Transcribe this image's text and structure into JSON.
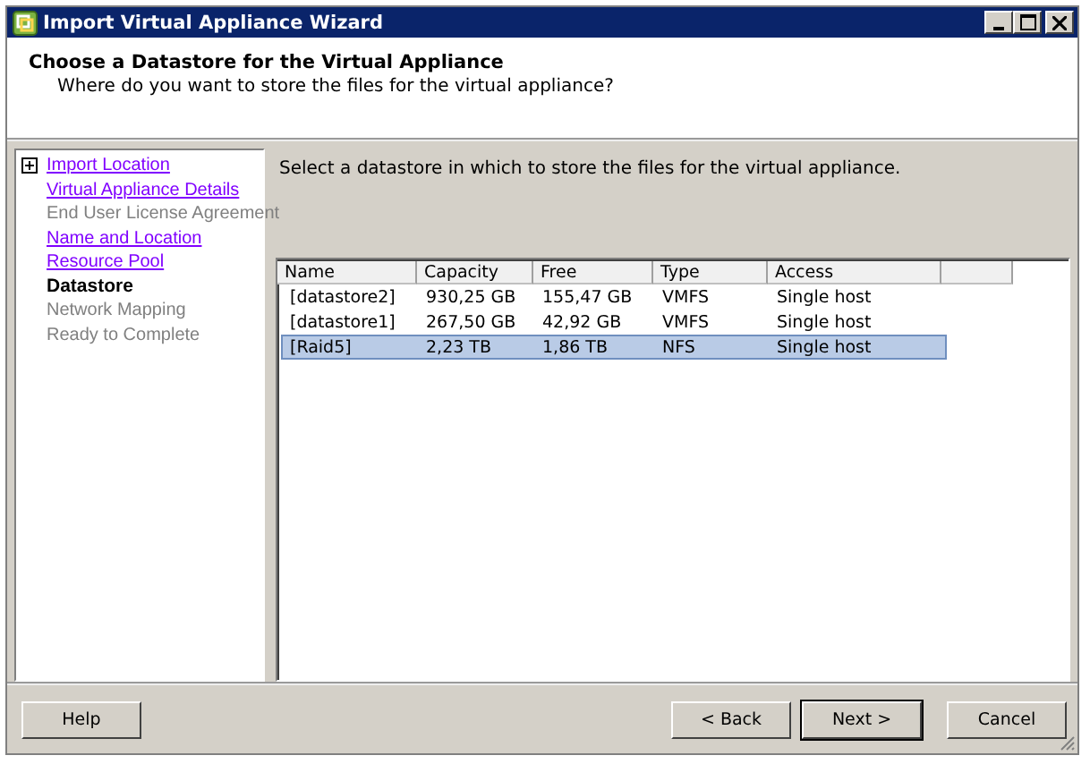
{
  "window": {
    "title": "Import Virtual Appliance Wizard"
  },
  "header": {
    "title": "Choose a Datastore for the Virtual Appliance",
    "subtitle": "Where do you want to store the files for the virtual appliance?"
  },
  "steps": [
    {
      "label": "Import Location",
      "kind": "link",
      "expandable": true
    },
    {
      "label": "Virtual Appliance Details",
      "kind": "link",
      "expandable": false
    },
    {
      "label": "End User License Agreement",
      "kind": "disabled",
      "expandable": false
    },
    {
      "label": "Name and Location",
      "kind": "link",
      "expandable": false
    },
    {
      "label": "Resource Pool",
      "kind": "link",
      "expandable": false
    },
    {
      "label": "Datastore",
      "kind": "current",
      "expandable": false
    },
    {
      "label": "Network Mapping",
      "kind": "disabled",
      "expandable": false
    },
    {
      "label": "Ready to Complete",
      "kind": "disabled",
      "expandable": false
    }
  ],
  "instruction": "Select a datastore in which to store the files for the virtual appliance.",
  "table": {
    "columns": [
      "Name",
      "Capacity",
      "Free",
      "Type",
      "Access"
    ],
    "rows": [
      {
        "cells": [
          "[datastore2]",
          "930,25 GB",
          "155,47 GB",
          "VMFS",
          "Single host"
        ],
        "selected": false
      },
      {
        "cells": [
          "[datastore1]",
          "267,50 GB",
          "42,92 GB",
          "VMFS",
          "Single host"
        ],
        "selected": false
      },
      {
        "cells": [
          "[Raid5]",
          "2,23 TB",
          "1,86 TB",
          "NFS",
          "Single host"
        ],
        "selected": true
      }
    ]
  },
  "buttons": {
    "help": "Help",
    "back": "< Back",
    "next": "Next >",
    "cancel": "Cancel"
  }
}
